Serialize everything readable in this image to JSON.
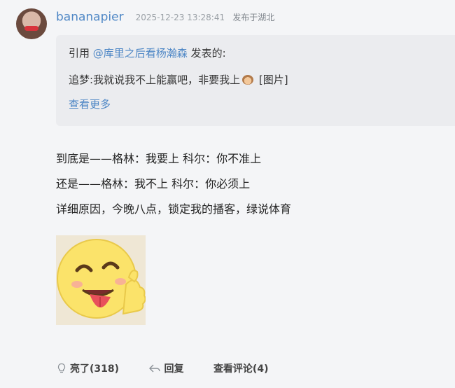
{
  "post": {
    "username": "bananapier",
    "timestamp": "2025-12-23 13:28:41",
    "location": "发布于湖北",
    "quote": {
      "prefix": "引用",
      "mention": "@库里之后看杨瀚森",
      "suffix": "发表的:",
      "author": "追梦:",
      "text": "我就说我不上能赢吧，非要我上",
      "emoji_icon": "dog-face-icon",
      "image_tag": "[图片]",
      "more_label": "查看更多"
    },
    "body_lines": [
      "到底是——格林：我要上 科尔：你不准上",
      "还是——格林：我不上 科尔：你必须上",
      "详细原因，今晚八点，锁定我的播客，绿说体育"
    ],
    "sticker_icon": "smiley-tongue-thumbs-up-icon",
    "actions": {
      "like_label": "亮了(318)",
      "reply_label": "回复",
      "comments_label": "查看评论(4)"
    }
  },
  "colors": {
    "link": "#4d86c5",
    "background": "#f4f5f7",
    "quote_bg": "#ebecef"
  }
}
